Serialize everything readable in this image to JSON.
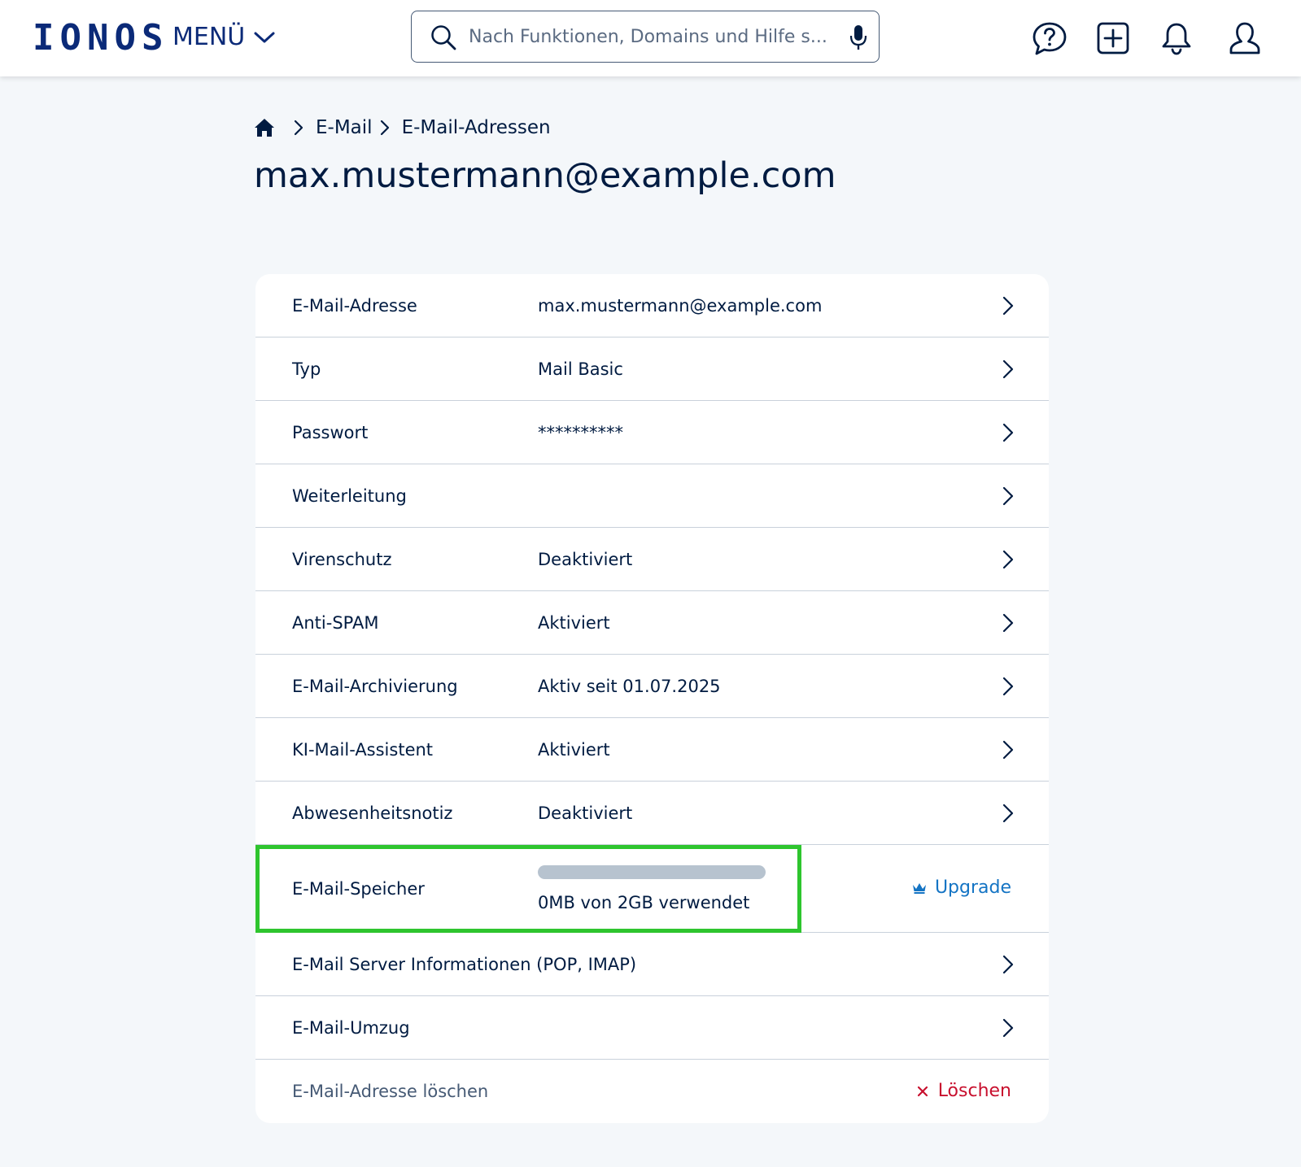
{
  "header": {
    "logo": "IONOS",
    "menu_label": "MENÜ",
    "search_placeholder": "Nach Funktionen, Domains und Hilfe s...",
    "icons": [
      "help-chat-icon",
      "add-icon",
      "bell-icon",
      "user-icon",
      "search-icon",
      "microphone-icon"
    ]
  },
  "breadcrumb": {
    "items": [
      "E-Mail",
      "E-Mail-Adressen"
    ]
  },
  "page_title": "max.mustermann@example.com",
  "rows": [
    {
      "label": "E-Mail-Adresse",
      "value": "max.mustermann@example.com"
    },
    {
      "label": "Typ",
      "value": "Mail Basic"
    },
    {
      "label": "Passwort",
      "value": "**********"
    },
    {
      "label": "Weiterleitung",
      "value": ""
    },
    {
      "label": "Virenschutz",
      "value": "Deaktiviert"
    },
    {
      "label": "Anti-SPAM",
      "value": "Aktiviert"
    },
    {
      "label": "E-Mail-Archivierung",
      "value": "Aktiv seit 01.07.2025"
    },
    {
      "label": "KI-Mail-Assistent",
      "value": "Aktiviert"
    },
    {
      "label": "Abwesenheitsnotiz",
      "value": "Deaktiviert"
    }
  ],
  "storage": {
    "label": "E-Mail-Speicher",
    "usage_text": "0MB von 2GB verwendet",
    "used_fraction": 0,
    "upgrade_label": "Upgrade"
  },
  "rows_after": [
    {
      "label": "E-Mail Server Informationen (POP, IMAP)"
    },
    {
      "label": "E-Mail-Umzug"
    }
  ],
  "delete": {
    "label": "E-Mail-Adresse löschen",
    "button_label": "Löschen"
  },
  "colors": {
    "brand": "#0b2a78",
    "text": "#001b41",
    "link": "#1474c4",
    "danger": "#c8102e",
    "highlight": "#2ec52e",
    "background": "#f4f7fa"
  }
}
